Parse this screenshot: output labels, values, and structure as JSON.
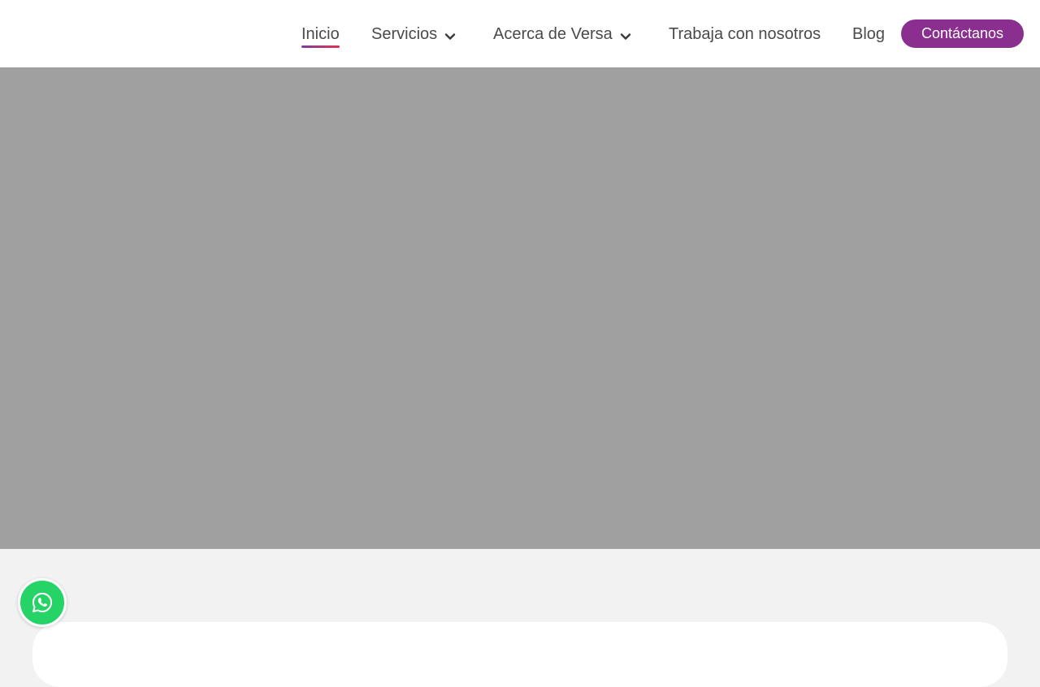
{
  "nav": {
    "items": [
      {
        "label": "Inicio",
        "active": true,
        "has_dropdown": false
      },
      {
        "label": "Servicios",
        "active": false,
        "has_dropdown": true
      },
      {
        "label": "Acerca de Versa",
        "active": false,
        "has_dropdown": true
      },
      {
        "label": "Trabaja con nosotros",
        "active": false,
        "has_dropdown": false
      },
      {
        "label": "Blog",
        "active": false,
        "has_dropdown": false
      }
    ],
    "cta_label": "Contáctanos"
  },
  "floating": {
    "whatsapp_icon": "whatsapp-icon"
  },
  "colors": {
    "brand": "#8a2f8f",
    "hero_placeholder": "#a0a0a0",
    "whatsapp": "#25d366",
    "active_underline_start": "#7b3fa0",
    "active_underline_end": "#e0344f"
  }
}
